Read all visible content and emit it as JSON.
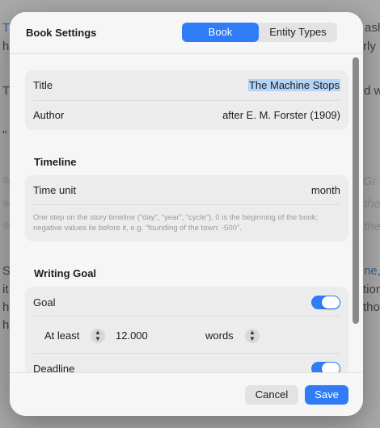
{
  "background": {
    "fragments": [
      "T",
      "ash",
      "h",
      "rly",
      "T",
      "d w",
      "\"",
      "%",
      "Gr",
      "%",
      "the",
      "%",
      "the",
      "S",
      "ne,",
      "it",
      "tion",
      "h",
      "tho",
      "h"
    ]
  },
  "dialog": {
    "title": "Book Settings",
    "tabs": [
      {
        "label": "Book",
        "active": true
      },
      {
        "label": "Entity Types",
        "active": false
      }
    ],
    "general": {
      "title_label": "Title",
      "title_value": "The Machine Stops",
      "author_label": "Author",
      "author_value": "after E. M. Forster (1909)"
    },
    "timeline": {
      "heading": "Timeline",
      "time_unit_label": "Time unit",
      "time_unit_value": "month",
      "hint": "One step on the story timeline (“day”, “year”, “cycle”). 0 is the beginning of the book; negative values lie before it, e.g. “founding of the town: -500”."
    },
    "writing_goal": {
      "heading": "Writing Goal",
      "goal_label": "Goal",
      "goal_enabled": true,
      "comparator": "At least",
      "amount": "12.000",
      "unit": "words",
      "deadline_label": "Deadline",
      "deadline_enabled": true
    },
    "footer": {
      "cancel_label": "Cancel",
      "save_label": "Save"
    }
  },
  "colors": {
    "accent": "#2f7cf6",
    "selection": "#b3d3f7"
  }
}
